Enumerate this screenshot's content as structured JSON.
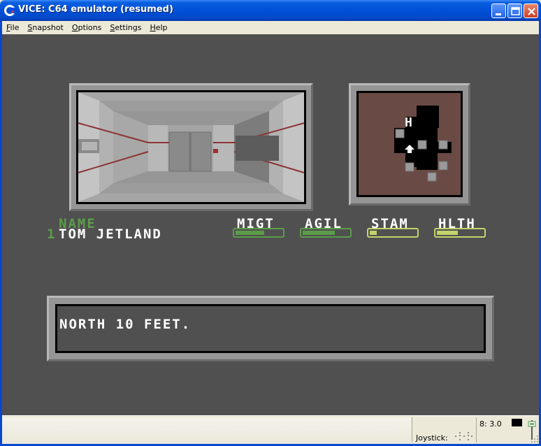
{
  "window": {
    "title": "VICE: C64 emulator (resumed)"
  },
  "menu": {
    "items": [
      "File",
      "Snapshot",
      "Options",
      "Settings",
      "Help"
    ]
  },
  "game": {
    "header_name": "NAME",
    "party_slot": "1",
    "character_name": "TOM JETLAND",
    "stats": [
      {
        "label": "MIGT",
        "level": 0.62,
        "color": "#5c9c4a"
      },
      {
        "label": "AGIL",
        "level": 0.7,
        "color": "#5c9c4a"
      },
      {
        "label": "STAM",
        "level": 0.15,
        "color": "#c4d46c"
      },
      {
        "label": "HLTH",
        "level": 0.45,
        "color": "#c4d46c"
      }
    ],
    "minimap_marker": "H",
    "message": "NORTH 10 FEET."
  },
  "status": {
    "speed": "8: 3.0",
    "joystick_label": "Joystick:"
  }
}
